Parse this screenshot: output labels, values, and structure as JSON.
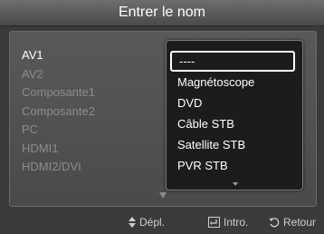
{
  "title": "Entrer le nom",
  "inputs": [
    "AV1",
    "AV2",
    "Composante1",
    "Composante2",
    "PC",
    "HDMI1",
    "HDMI2/DVI"
  ],
  "dropdown": {
    "options": [
      "----",
      "Magnétoscope",
      "DVD",
      "Câble STB",
      "Satellite STB",
      "PVR STB"
    ]
  },
  "footer": {
    "move_label": "Dépl.",
    "enter_label": "Intro.",
    "return_label": "Retour"
  }
}
